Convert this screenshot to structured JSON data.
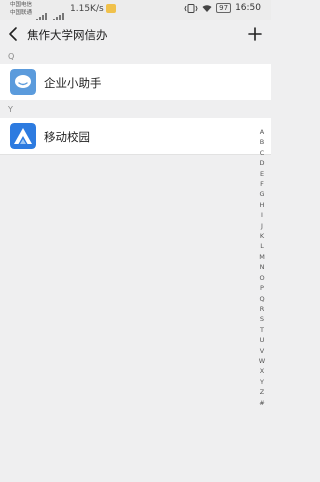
{
  "status_bar": {
    "carrier_1": "中国电信",
    "carrier_2": "中国联通",
    "net_speed": "1.15K/s",
    "battery": "97",
    "time": "16:50"
  },
  "header": {
    "title": "焦作大学网信办",
    "back_icon": "chevron-left-icon",
    "add_icon": "plus-icon"
  },
  "sections": [
    {
      "label": "Q",
      "items": [
        {
          "label": "企业小助手",
          "icon": "chat-bubble-icon",
          "icon_color": "#5b9bdc"
        }
      ]
    },
    {
      "label": "Y",
      "items": [
        {
          "label": "移动校园",
          "icon": "mountain-a-icon",
          "icon_color": "#2d7be0"
        }
      ]
    }
  ],
  "alphabet": [
    "A",
    "B",
    "C",
    "D",
    "E",
    "F",
    "G",
    "H",
    "I",
    "J",
    "K",
    "L",
    "M",
    "N",
    "O",
    "P",
    "Q",
    "R",
    "S",
    "T",
    "U",
    "V",
    "W",
    "X",
    "Y",
    "Z",
    "#"
  ]
}
